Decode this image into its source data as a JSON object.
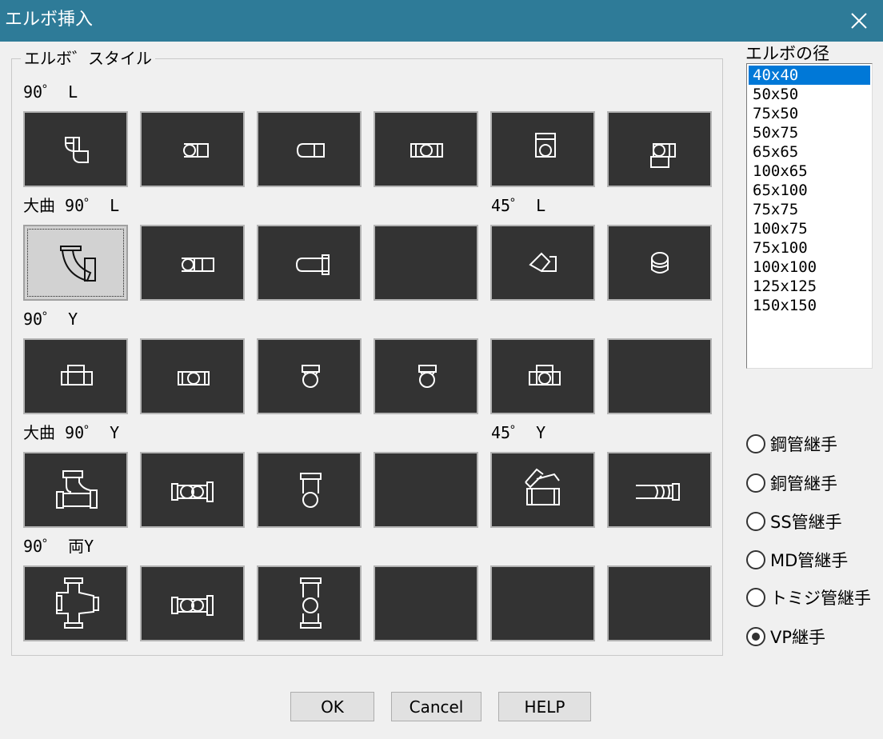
{
  "window": {
    "title": "エルボ挿入"
  },
  "group": {
    "title": "エルボ゛スタイル"
  },
  "rows": [
    {
      "label": "90゜ L",
      "label2": ""
    },
    {
      "label": "大曲 90゜ L",
      "label2": "45゜ L"
    },
    {
      "label": "90゜ Y",
      "label2": ""
    },
    {
      "label": "大曲 90゜ Y",
      "label2": "45゜ Y"
    },
    {
      "label": "90゜ 両Y",
      "label2": ""
    }
  ],
  "diameter": {
    "label": "エルボの径",
    "options": [
      "40x40",
      "50x50",
      "75x50",
      "50x75",
      "65x65",
      "100x65",
      "65x100",
      "75x75",
      "100x75",
      "75x100",
      "100x100",
      "125x125",
      "150x150"
    ],
    "selected": "40x40"
  },
  "joint_types": {
    "options": [
      "鋼管継手",
      "銅管継手",
      "SS管継手",
      "MD管継手",
      "トミジ管継手",
      "VP継手"
    ],
    "selected": "VP継手"
  },
  "buttons": {
    "ok": "OK",
    "cancel": "Cancel",
    "help": "HELP"
  },
  "colors": {
    "titlebar": "#2e7b98",
    "tile_background": "#333333",
    "selection": "#0078d7"
  }
}
